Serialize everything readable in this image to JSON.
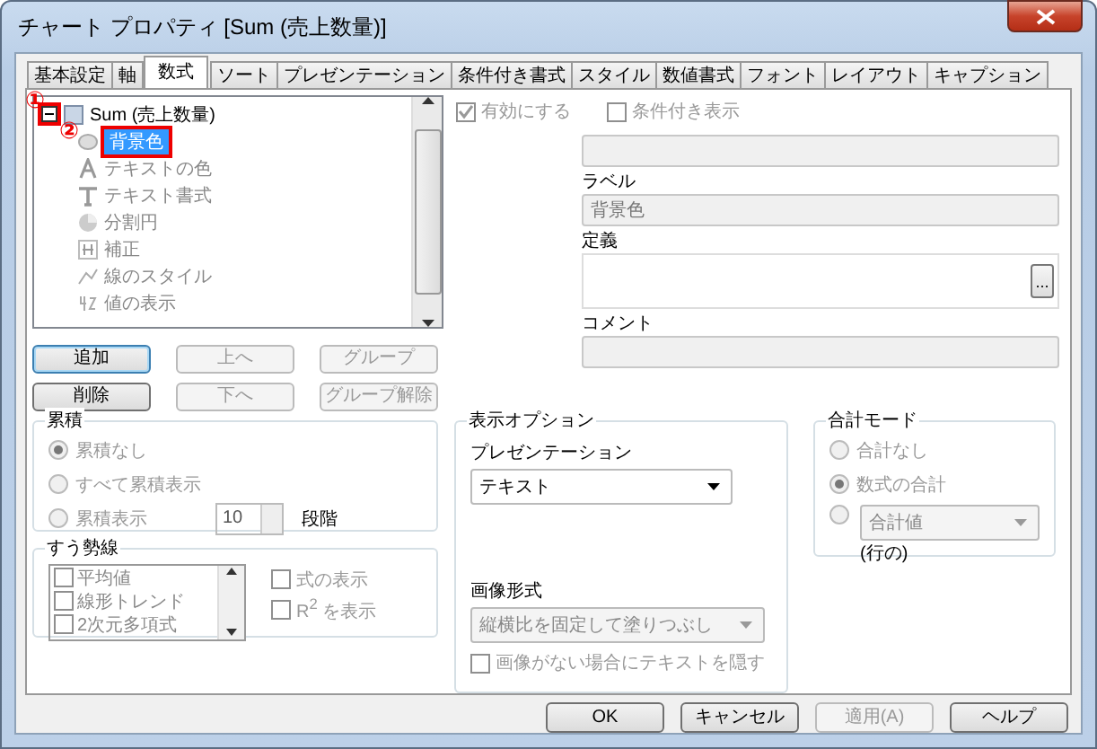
{
  "window": {
    "title": "チャート プロパティ [Sum (売上数量)]"
  },
  "tabs": [
    {
      "label": "基本設定",
      "selected": false
    },
    {
      "label": "軸",
      "selected": false
    },
    {
      "label": "数式",
      "selected": true
    },
    {
      "label": "ソート",
      "selected": false
    },
    {
      "label": "プレゼンテーション",
      "selected": false
    },
    {
      "label": "条件付き書式",
      "selected": false
    },
    {
      "label": "スタイル",
      "selected": false
    },
    {
      "label": "数値書式",
      "selected": false
    },
    {
      "label": "フォント",
      "selected": false
    },
    {
      "label": "レイアウト",
      "selected": false
    },
    {
      "label": "キャプション",
      "selected": false
    }
  ],
  "expression_tree": {
    "label": "Sum (売上数量)",
    "expanded": true,
    "marker": "①",
    "children": [
      {
        "label": "背景色",
        "kind": "color",
        "selected": true,
        "marker": "②"
      },
      {
        "label": "テキストの色",
        "kind": "text-color",
        "selected": false
      },
      {
        "label": "テキスト書式",
        "kind": "text-format",
        "selected": false
      },
      {
        "label": "分割円",
        "kind": "pie",
        "selected": false
      },
      {
        "label": "補正",
        "kind": "adjust",
        "selected": false
      },
      {
        "label": "線のスタイル",
        "kind": "line-style",
        "selected": false
      },
      {
        "label": "値の表示",
        "kind": "value",
        "selected": false
      }
    ]
  },
  "tree_buttons": [
    {
      "label": "追加",
      "disabled": false
    },
    {
      "label": "上へ",
      "disabled": true
    },
    {
      "label": "グループ",
      "disabled": true
    },
    {
      "label": "削除",
      "disabled": false
    },
    {
      "label": "下へ",
      "disabled": true
    },
    {
      "label": "グループ解除",
      "disabled": true
    }
  ],
  "enable_checkbox": {
    "label": "有効にする",
    "checked": true,
    "disabled": true
  },
  "conditional_checkbox": {
    "label": "条件付き表示",
    "checked": false
  },
  "label_field": {
    "label": "ラベル",
    "value": "背景色"
  },
  "definition_field": {
    "label": "定義",
    "button": "..."
  },
  "comment_field": {
    "label": "コメント"
  },
  "accumulation": {
    "title": "累積",
    "options": [
      {
        "label": "累積なし",
        "selected": true
      },
      {
        "label": "すべて累積表示",
        "selected": false
      },
      {
        "label": "累積表示",
        "selected": false
      }
    ],
    "steps": "10",
    "steps_unit": "段階"
  },
  "trendlines": {
    "title": "すう勢線",
    "items": [
      {
        "label": "平均値",
        "checked": false
      },
      {
        "label": "線形トレンド",
        "checked": false
      },
      {
        "label": "2次元多項式",
        "checked": false
      }
    ],
    "options": [
      {
        "label": "式の表示",
        "checked": false
      },
      {
        "label": "R$^{2}$ を表示",
        "checked": false
      }
    ]
  },
  "display_options": {
    "title": "表示オプション",
    "presentation_label": "プレゼンテーション",
    "presentation": "テキスト",
    "image_format_label": "画像形式",
    "image_format": "縦横比を固定して塗りつぶし",
    "hide_text": {
      "label": "画像がない場合にテキストを隠す",
      "checked": false
    }
  },
  "total_mode": {
    "title": "合計モード",
    "options": [
      {
        "label": "合計なし",
        "selected": false
      },
      {
        "label": "数式の合計",
        "selected": true
      },
      {
        "value": "合計値",
        "suffix": "(行の)",
        "selected": false
      }
    ]
  },
  "footer_buttons": [
    {
      "label": "OK",
      "disabled": false
    },
    {
      "label": "キャンセル",
      "disabled": false
    },
    {
      "label": "適用(A)",
      "disabled": true
    },
    {
      "label": "ヘルプ",
      "disabled": false
    }
  ]
}
